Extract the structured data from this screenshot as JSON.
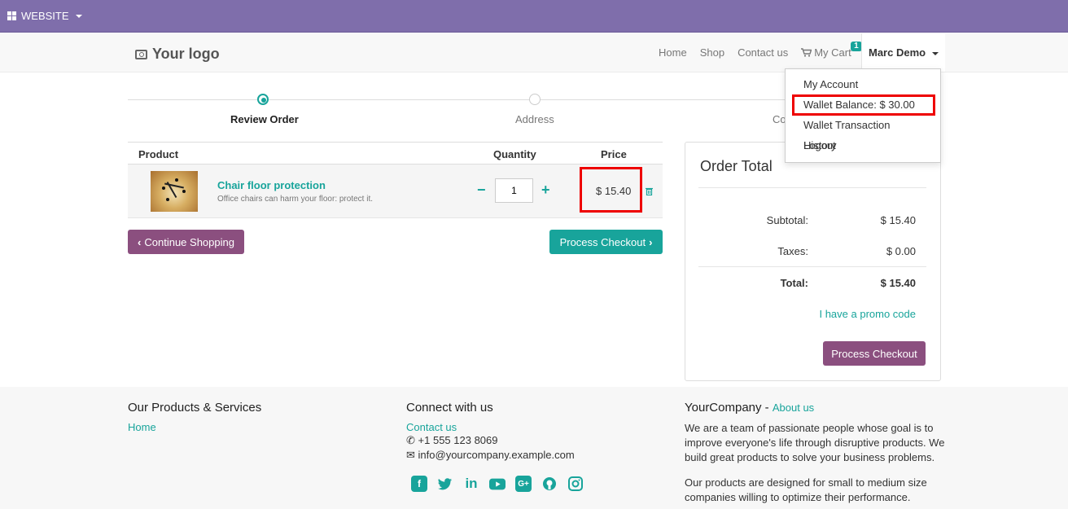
{
  "topbar": {
    "website_label": "WEBSITE"
  },
  "navbar": {
    "logo_text": "Your logo",
    "links": [
      "Home",
      "Shop",
      "Contact us"
    ],
    "cart_label": "My Cart",
    "cart_count": "1",
    "user_name": "Marc Demo"
  },
  "dropdown": {
    "items": [
      "My Account",
      "Wallet Balance: $ 30.00",
      "Wallet Transaction History",
      "Logout"
    ]
  },
  "steps": [
    "Review Order",
    "Address",
    "Co"
  ],
  "cart": {
    "headers": {
      "product": "Product",
      "quantity": "Quantity",
      "price": "Price"
    },
    "row": {
      "name": "Chair floor protection",
      "description": "Office chairs can harm your floor: protect it.",
      "quantity": "1",
      "price": "$ 15.40"
    }
  },
  "buttons": {
    "continue": "Continue Shopping",
    "checkout": "Process Checkout"
  },
  "order_total": {
    "title": "Order Total",
    "subtotal_label": "Subtotal:",
    "subtotal": "$ 15.40",
    "taxes_label": "Taxes:",
    "taxes": "$ 0.00",
    "total_label": "Total:",
    "total": "$ 15.40",
    "promo": "I have a promo code",
    "checkout": "Process Checkout"
  },
  "footer": {
    "col1": {
      "title": "Our Products & Services",
      "link": "Home"
    },
    "col2": {
      "title": "Connect with us",
      "link": "Contact us",
      "phone": "+1 555 123 8069",
      "email": "info@yourcompany.example.com"
    },
    "col3": {
      "title": "YourCompany",
      "about": "About us",
      "p1": "We are a team of passionate people whose goal is to improve everyone's life through disruptive products. We build great products to solve your business problems.",
      "p2": "Our products are designed for small to medium size companies willing to optimize their performance."
    },
    "social_icons": [
      "facebook-icon",
      "twitter-icon",
      "linkedin-icon",
      "youtube-icon",
      "google-plus-icon",
      "github-icon",
      "instagram-icon"
    ]
  },
  "colors": {
    "topbar": "#7f6eab",
    "accent": "#18a49b",
    "purple_button": "#8b4f7f",
    "highlight": "#e00000"
  }
}
